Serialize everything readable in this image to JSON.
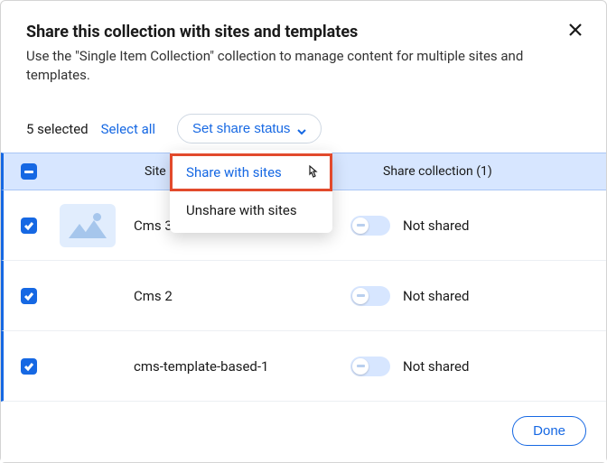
{
  "header": {
    "title": "Share this collection with sites and templates",
    "subtitle": "Use the \"Single Item Collection\" collection to manage content for multiple sites and templates."
  },
  "controls": {
    "selected_count_label": "5 selected",
    "select_all_label": "Select all",
    "set_status_label": "Set share status",
    "menu": {
      "share": "Share with sites",
      "unshare": "Unshare with sites"
    }
  },
  "columns": {
    "site": "Site",
    "share": "Share collection (1)"
  },
  "rows": [
    {
      "name": "Cms 3",
      "status": "Not shared",
      "thumb": "placeholder"
    },
    {
      "name": "Cms 2",
      "status": "Not shared",
      "thumb": "blank"
    },
    {
      "name": "cms-template-based-1",
      "status": "Not shared",
      "thumb": "blank"
    }
  ],
  "footer": {
    "done": "Done"
  }
}
